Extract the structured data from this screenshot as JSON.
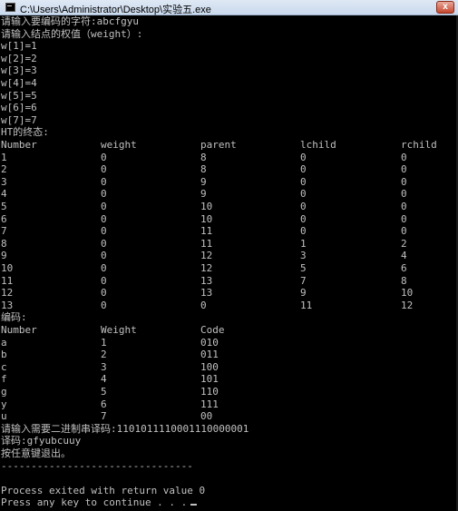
{
  "window": {
    "title": "C:\\Users\\Administrator\\Desktop\\实验五.exe",
    "close_glyph": "x"
  },
  "console": {
    "prompt_chars": "请输入要编码的字符:abcfgyu",
    "prompt_weights": "请输入结点的权值（weight）:",
    "weights": [
      "w[1]=1",
      "w[2]=2",
      "w[3]=3",
      "w[4]=4",
      "w[5]=5",
      "w[6]=6",
      "w[7]=7"
    ],
    "ht_title": "HT的终态:",
    "ht_headers": [
      "Number",
      "weight",
      "parent",
      "lchild",
      "rchild"
    ],
    "ht_rows": [
      [
        "1",
        "0",
        "8",
        "0",
        "0"
      ],
      [
        "2",
        "0",
        "8",
        "0",
        "0"
      ],
      [
        "3",
        "0",
        "9",
        "0",
        "0"
      ],
      [
        "4",
        "0",
        "9",
        "0",
        "0"
      ],
      [
        "5",
        "0",
        "10",
        "0",
        "0"
      ],
      [
        "6",
        "0",
        "10",
        "0",
        "0"
      ],
      [
        "7",
        "0",
        "11",
        "0",
        "0"
      ],
      [
        "8",
        "0",
        "11",
        "1",
        "2"
      ],
      [
        "9",
        "0",
        "12",
        "3",
        "4"
      ],
      [
        "10",
        "0",
        "12",
        "5",
        "6"
      ],
      [
        "11",
        "0",
        "13",
        "7",
        "8"
      ],
      [
        "12",
        "0",
        "13",
        "9",
        "10"
      ],
      [
        "13",
        "0",
        "0",
        "11",
        "12"
      ]
    ],
    "code_title": "编码:",
    "code_headers": [
      "Number",
      "Weight",
      "Code"
    ],
    "code_rows": [
      [
        "a",
        "1",
        "010"
      ],
      [
        "b",
        "2",
        "011"
      ],
      [
        "c",
        "3",
        "100"
      ],
      [
        "f",
        "4",
        "101"
      ],
      [
        "g",
        "5",
        "110"
      ],
      [
        "y",
        "6",
        "111"
      ],
      [
        "u",
        "7",
        "00"
      ]
    ],
    "decode_prompt": "请输入需要二进制串译码:1101011110001110000001",
    "decode_result": "译码:gfyubcuuy",
    "exit_prompt": "按任意键退出。",
    "separator": "--------------------------------",
    "process_exit": "Process exited with return value 0",
    "press_key": "Press any key to continue . . ."
  }
}
